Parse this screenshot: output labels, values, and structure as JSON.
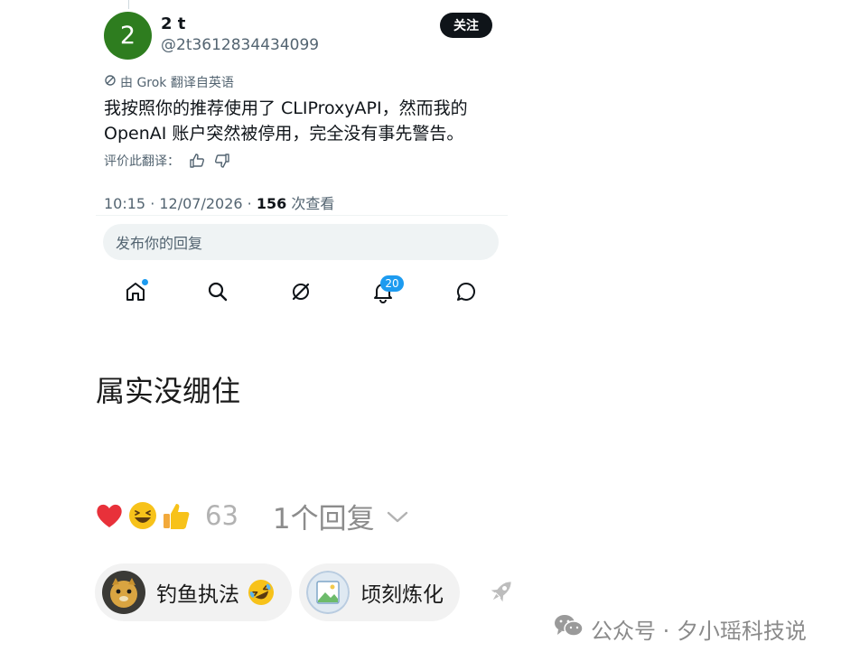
{
  "tweet": {
    "avatar_letter": "2",
    "display_name": "2 t",
    "handle": "@2t3612834434099",
    "follow_label": "关注",
    "translated_note": "由 Grok 翻译自英语",
    "body_line1": "我按照你的推荐使用了 CLIProxyAPI，然而我的",
    "body_line2": "OpenAI 账户突然被停用，完全没有事先警告。",
    "rate_label": "评价此翻译：",
    "time_date": "10:15 · 12/07/2026 · ",
    "views_count": "156",
    "views_label": " 次查看",
    "reply_placeholder": "发布你的回复"
  },
  "tabbar": {
    "notification_badge": "20",
    "icons": [
      "home-icon",
      "search-icon",
      "grok-icon",
      "bell-icon",
      "message-icon"
    ]
  },
  "comment": {
    "text": "属实没绷住",
    "reactions": [
      "heart-emoji",
      "laughing-emoji",
      "thumbs-up-emoji"
    ],
    "reaction_count": "63",
    "reply_count_label": "1个回复"
  },
  "chips": [
    {
      "label": "钓鱼执法",
      "emoji": "rolling-laughing-emoji"
    },
    {
      "label": "顷刻炼化"
    }
  ],
  "watermark": {
    "text": "公众号 · 夕小瑶科技说"
  },
  "colors": {
    "accent_blue": "#1d9bf0",
    "avatar_green": "#2e7d1f",
    "heart_red": "#e8313a"
  }
}
